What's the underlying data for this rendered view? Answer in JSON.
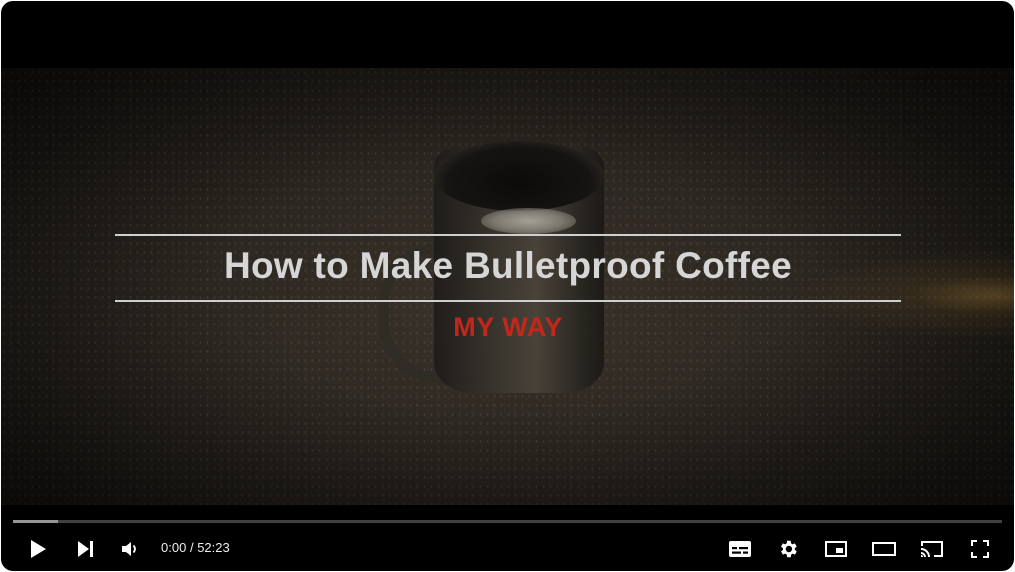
{
  "video": {
    "title_overlay": "How to Make Bulletproof Coffee",
    "subtitle_overlay": "MY WAY"
  },
  "player": {
    "progress_played_fraction": 0.0,
    "progress_buffered_fraction": 0.045,
    "time": {
      "current": "0:00",
      "separator": "/",
      "duration": "52:23"
    },
    "controls": {
      "play_icon": "play-icon",
      "next_icon": "next-track-icon",
      "volume_icon": "volume-icon",
      "subtitles_icon": "subtitles-icon",
      "settings_icon": "gear-icon",
      "miniplayer_icon": "miniplayer-icon",
      "theater_icon": "theater-mode-icon",
      "cast_icon": "cast-icon",
      "fullscreen_icon": "fullscreen-icon"
    },
    "colors": {
      "title_color": "#d6d6d6",
      "subtitle_color": "#c4261c",
      "player_bg": "#000000"
    }
  }
}
